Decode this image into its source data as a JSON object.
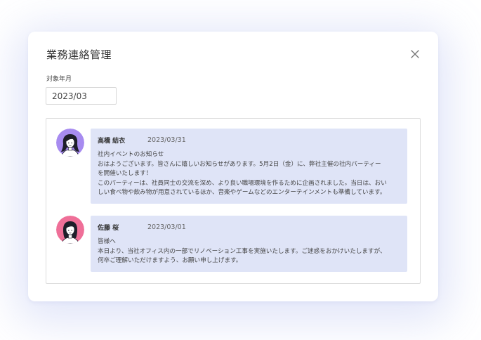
{
  "dialog": {
    "title": "業務連絡管理",
    "close_icon": "close-icon"
  },
  "filter": {
    "label": "対象年月",
    "value": "2023/03"
  },
  "messages": [
    {
      "author": "高橋 結衣",
      "date": "2023/03/31",
      "avatar_icon": "woman-avatar-purple",
      "avatar_color": "#a78bf0",
      "lines": [
        "社内イベントのお知らせ",
        "おはようございます。皆さんに嬉しいお知らせがあります。5月2日（金）に、弊社主催の社内パーティー",
        "を開催いたします！",
        "このパーティーは、社員同士の交流を深め、より良い職場環境を作るために企画されました。当日は、おい",
        "しい食べ物や飲み物が用意されているほか、音楽やゲームなどのエンターテインメントも準備しています。"
      ]
    },
    {
      "author": "佐藤 桜",
      "date": "2023/03/01",
      "avatar_icon": "woman-avatar-pink",
      "avatar_color": "#ef6f98",
      "lines": [
        "皆様へ",
        "本日より、当社オフィス内の一部でリノベーション工事を実施いたします。ご迷惑をおかけいたしますが、",
        "何卒ご理解いただけますよう、お願い申し上げます。"
      ]
    }
  ],
  "colors": {
    "bubble": "#dfe4f7",
    "halo": "#96a5eb"
  }
}
